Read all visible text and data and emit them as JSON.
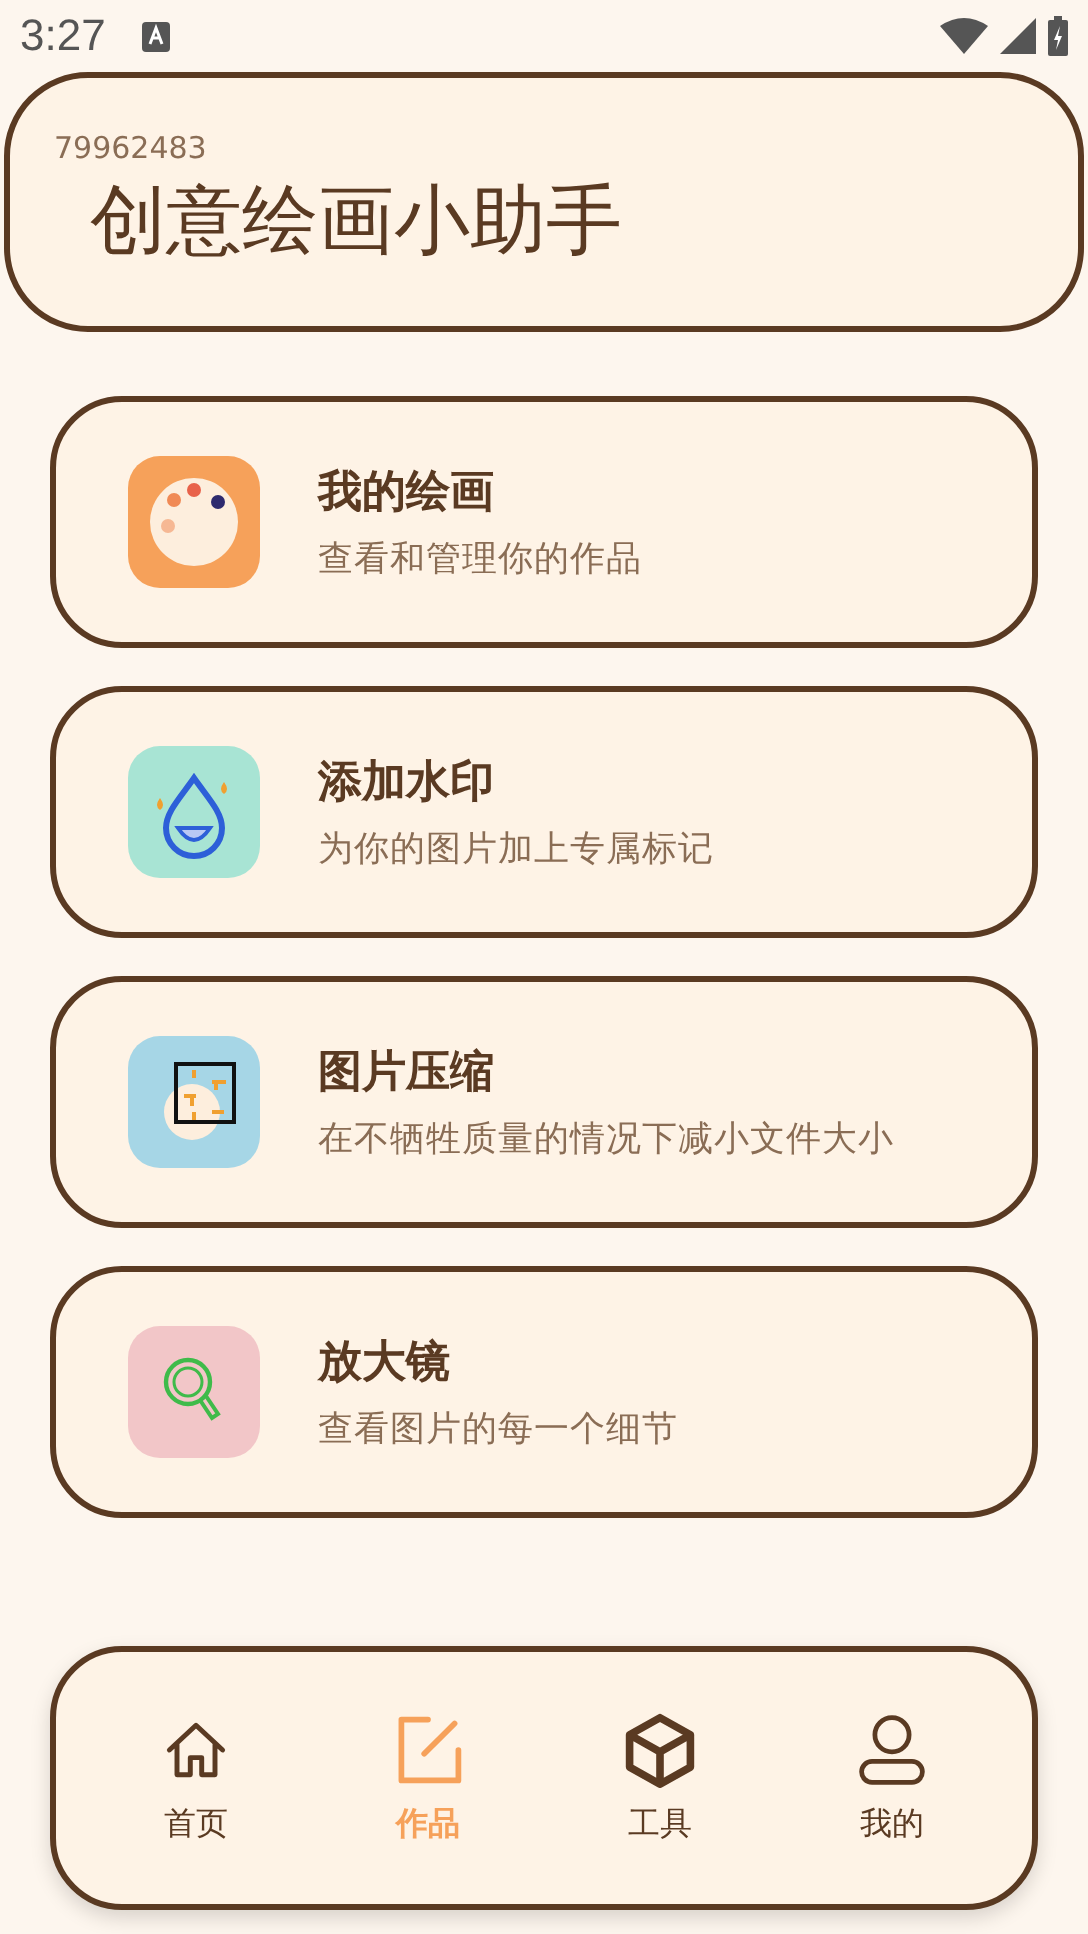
{
  "status_bar": {
    "time": "3:27"
  },
  "header": {
    "number": "79962483",
    "title": "创意绘画小助手"
  },
  "features": [
    {
      "kind": "palette",
      "title": "我的绘画",
      "subtitle": "查看和管理你的作品"
    },
    {
      "kind": "drop",
      "title": "添加水印",
      "subtitle": "为你的图片加上专属标记"
    },
    {
      "kind": "compress",
      "title": "图片压缩",
      "subtitle": "在不牺牲质量的情况下减小文件大小"
    },
    {
      "kind": "magnifier",
      "title": "放大镜",
      "subtitle": "查看图片的每一个细节"
    }
  ],
  "nav": [
    {
      "kind": "home",
      "label": "首页",
      "selected": false
    },
    {
      "kind": "edit",
      "label": "作品",
      "selected": true
    },
    {
      "kind": "box",
      "label": "工具",
      "selected": false
    },
    {
      "kind": "user",
      "label": "我的",
      "selected": false
    }
  ]
}
